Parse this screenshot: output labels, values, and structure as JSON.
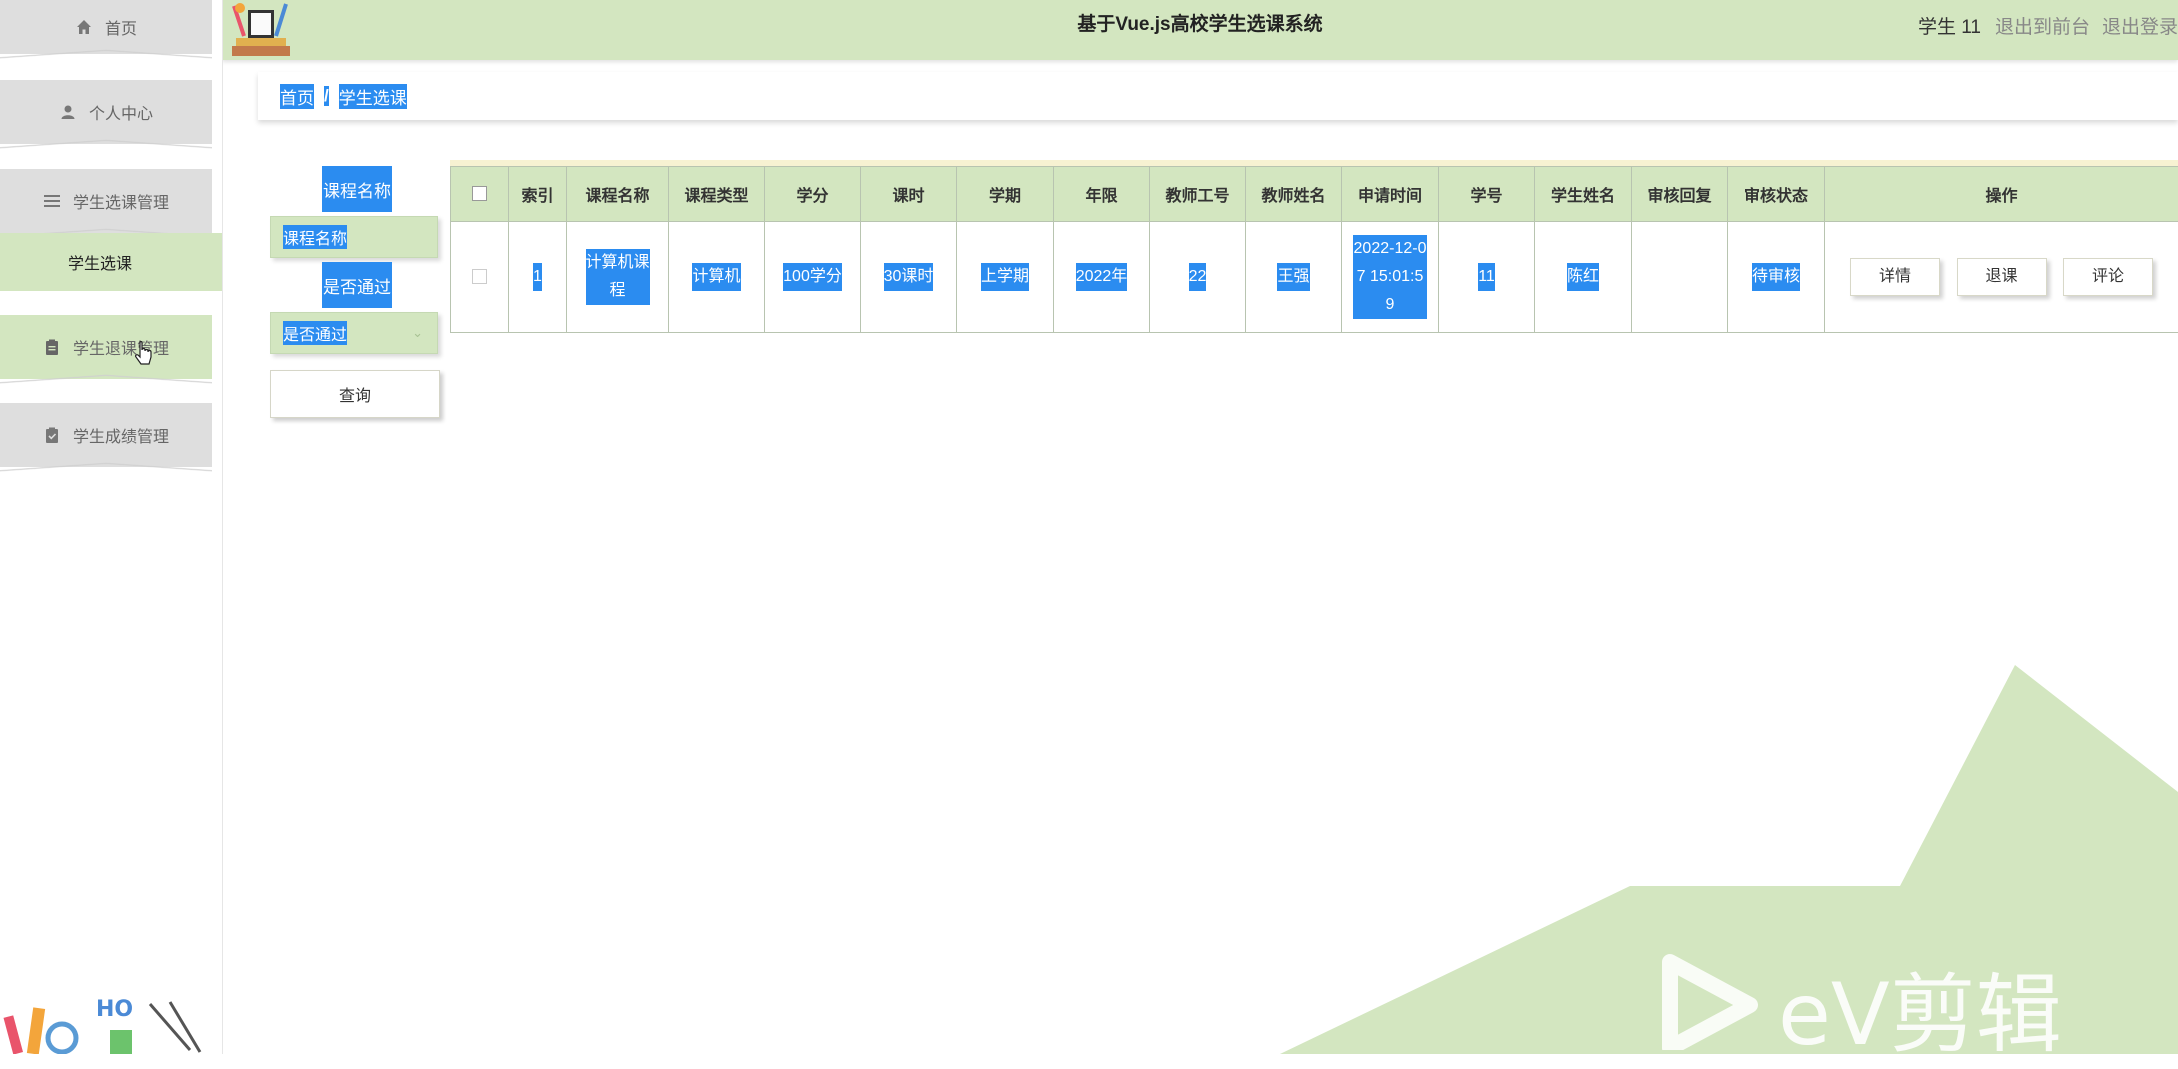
{
  "sidebar": {
    "items": [
      {
        "label": "首页",
        "icon": "home-icon"
      },
      {
        "label": "个人中心",
        "icon": "user-icon"
      },
      {
        "label": "学生选课管理",
        "icon": "list-icon"
      },
      {
        "label": "学生退课管理",
        "icon": "clipboard-icon"
      },
      {
        "label": "学生成绩管理",
        "icon": "clipboard-check-icon"
      }
    ],
    "submenu": {
      "label": "学生选课"
    }
  },
  "header": {
    "title": "基于Vue.js高校学生选课系统",
    "user": "学生 11",
    "front_link": "退出到前台",
    "logout_link": "退出登录"
  },
  "breadcrumb": {
    "home": "首页",
    "separator": "/",
    "current": "学生选课"
  },
  "search": {
    "course_label": "课程名称",
    "course_placeholder": "课程名称",
    "pass_label": "是否通过",
    "pass_placeholder": "是否通过",
    "query_button": "查询"
  },
  "table": {
    "columns": [
      "索引",
      "课程名称",
      "课程类型",
      "学分",
      "课时",
      "学期",
      "年限",
      "教师工号",
      "教师姓名",
      "申请时间",
      "学号",
      "学生姓名",
      "审核回复",
      "审核状态",
      "操作"
    ],
    "rows": [
      {
        "index": "1",
        "course_name": "计算机课程",
        "course_type": "计算机",
        "credit": "100学分",
        "hours": "30课时",
        "term": "上学期",
        "year": "2022年",
        "teacher_id": "22",
        "teacher_name": "王强",
        "apply_time": "2022-12-07 15:01:59",
        "student_id": "11",
        "student_name": "陈红",
        "review_reply": "",
        "review_status": "待审核"
      }
    ],
    "actions": [
      "详情",
      "退课",
      "评论"
    ]
  },
  "watermark": {
    "text": "eV剪辑"
  },
  "colors": {
    "accent_green": "#d3e6c0",
    "selection_blue": "#2b8cf0"
  }
}
